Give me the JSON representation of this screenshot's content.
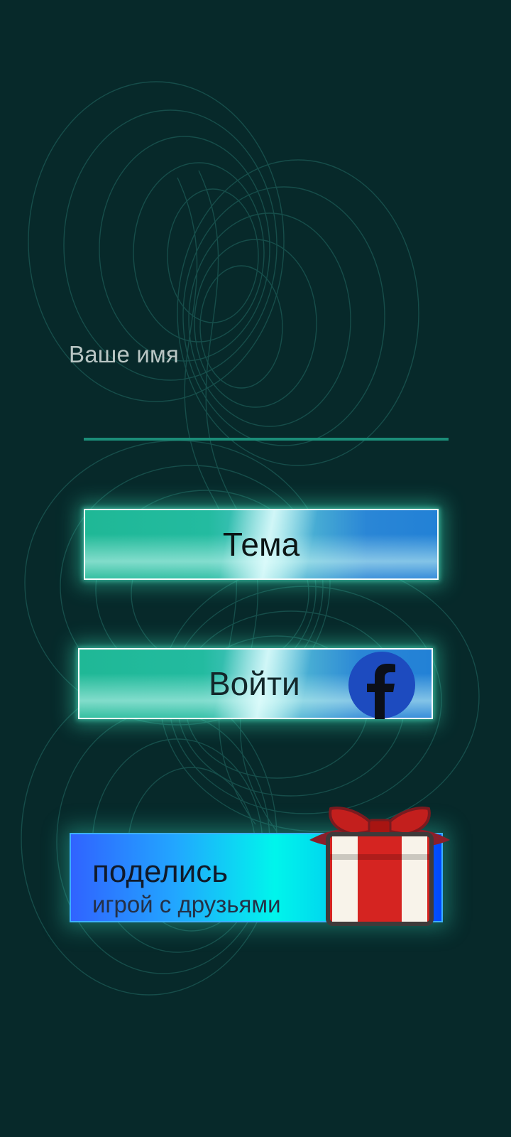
{
  "form": {
    "name_label": "Ваше имя",
    "name_value": "",
    "name_placeholder": ""
  },
  "buttons": {
    "theme_label": "Тема",
    "login_label": "Войти",
    "share_title": "поделись",
    "share_subtitle": "игрой с друзьями"
  },
  "icons": {
    "facebook": "facebook-icon",
    "gift": "gift-icon"
  },
  "colors": {
    "background": "#07292a",
    "input_underline": "#1b8d78",
    "facebook_blue": "#1d4bbf",
    "gift_red": "#d52421",
    "gift_ribbon": "#f8f3ea"
  }
}
